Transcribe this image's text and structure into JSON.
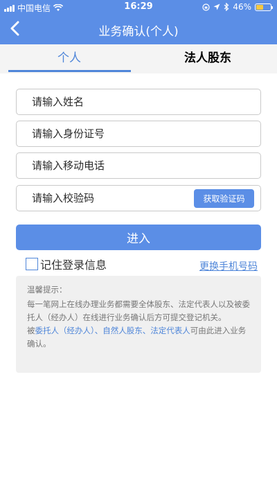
{
  "status_bar": {
    "carrier": "中国电信",
    "time": "16:29",
    "battery": "46%",
    "battery_level": 46
  },
  "header": {
    "back_icon": "chevron-left-icon",
    "title": "业务确认(个人)"
  },
  "tabs": [
    {
      "label": "个人",
      "active": true
    },
    {
      "label": "法人股东",
      "active": false
    }
  ],
  "form": {
    "name_placeholder": "请输入姓名",
    "id_placeholder": "请输入身份证号",
    "phone_placeholder": "请输入移动电话",
    "code_placeholder": "请输入校验码",
    "get_code_label": "获取验证码",
    "enter_label": "进入",
    "remember_label": "记住登录信息",
    "change_phone_label": "更换手机号码"
  },
  "tips": {
    "title": "温馨提示：",
    "line1": " 每一笔网上在线办理业务都需要全体股东、法定代表人以及被委托人（经办人）在线进行业务确认后方可提交登记机关。",
    "line2_prefix": " 被",
    "line2_link": "委托人（经办人）、自然人股东、法定代表人",
    "line2_suffix": "可由此进入业务确认。"
  },
  "colors": {
    "accent": "#5b8ee6",
    "tab_active": "#4f86d9"
  }
}
